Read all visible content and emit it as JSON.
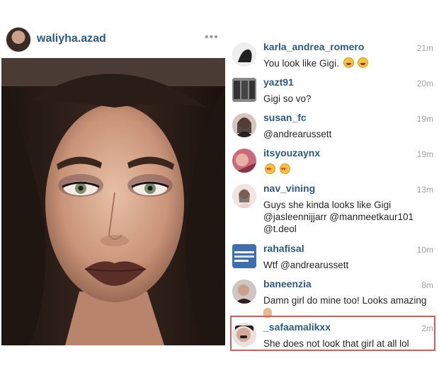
{
  "post": {
    "username": "waliyha.azad",
    "more_icon": "more-horizontal-icon"
  },
  "comments": [
    {
      "user": "karla_andrea_romero",
      "time": "21m",
      "text": "You look like Gigi.",
      "emoji": [
        "laughing-tears",
        "laughing-tears"
      ]
    },
    {
      "user": "yazt91",
      "time": "20m",
      "text": "Gigi so vo?"
    },
    {
      "user": "susan_fc",
      "time": "19m",
      "text": "@andrearussett"
    },
    {
      "user": "itsyouzaynx",
      "time": "19m",
      "text": "",
      "emoji": [
        "heart-eyes",
        "heart-eyes"
      ]
    },
    {
      "user": "nav_vining",
      "time": "13m",
      "text_lines": [
        "Guys she kinda looks like Gigi",
        "@jasleennijjarr @manmeetkaur101",
        "@t.deol"
      ]
    },
    {
      "user": "rahafisal",
      "time": "10m",
      "text": "Wtf @andrearussett"
    },
    {
      "user": "baneenzia",
      "time": "8m",
      "text": "Damn girl do mine too! Looks amazing",
      "emoji": [
        "ok-hand"
      ]
    },
    {
      "user": "_safaamalikxx",
      "time": "2m",
      "text": "She does not look that girl at all lol",
      "highlighted": true
    }
  ],
  "colors": {
    "username": "#2b5b84",
    "timestamp": "#a0a0a0",
    "highlight": "#e05a5a"
  }
}
